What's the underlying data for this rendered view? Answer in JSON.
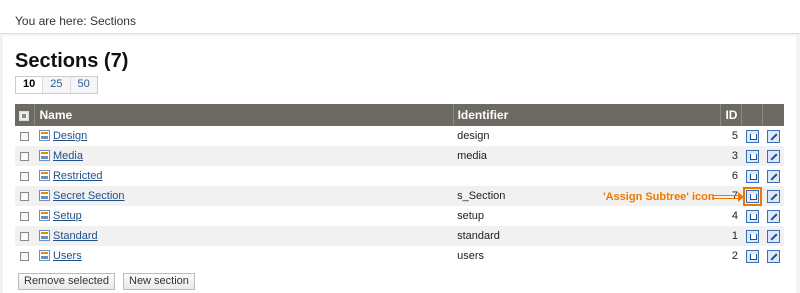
{
  "breadcrumb": {
    "text": "You are here: Sections"
  },
  "page": {
    "title": "Sections (7)"
  },
  "pager": {
    "items": [
      {
        "label": "10",
        "active": true
      },
      {
        "label": "25",
        "active": false
      },
      {
        "label": "50",
        "active": false
      }
    ]
  },
  "table": {
    "headers": {
      "toggle_icon": "toggle-selection-icon",
      "name": "Name",
      "identifier": "Identifier",
      "id": "ID"
    },
    "rows": [
      {
        "name": "Design",
        "identifier": "design",
        "id": "5"
      },
      {
        "name": "Media",
        "identifier": "media",
        "id": "3"
      },
      {
        "name": "Restricted",
        "identifier": "",
        "id": "6"
      },
      {
        "name": "Secret Section",
        "identifier": "s_Section",
        "id": "7"
      },
      {
        "name": "Setup",
        "identifier": "setup",
        "id": "4"
      },
      {
        "name": "Standard",
        "identifier": "standard",
        "id": "1"
      },
      {
        "name": "Users",
        "identifier": "users",
        "id": "2"
      }
    ],
    "row_icons": {
      "section": "section-icon",
      "assign": "assign-subtree-icon",
      "edit": "edit-icon"
    }
  },
  "annotation": {
    "text": "'Assign Subtree' icon",
    "color": "#f07800"
  },
  "buttons": {
    "remove": "Remove selected",
    "new": "New section"
  },
  "colors": {
    "header_bg": "#6d6a63",
    "link": "#1f4f8a",
    "highlight": "#f07800"
  }
}
